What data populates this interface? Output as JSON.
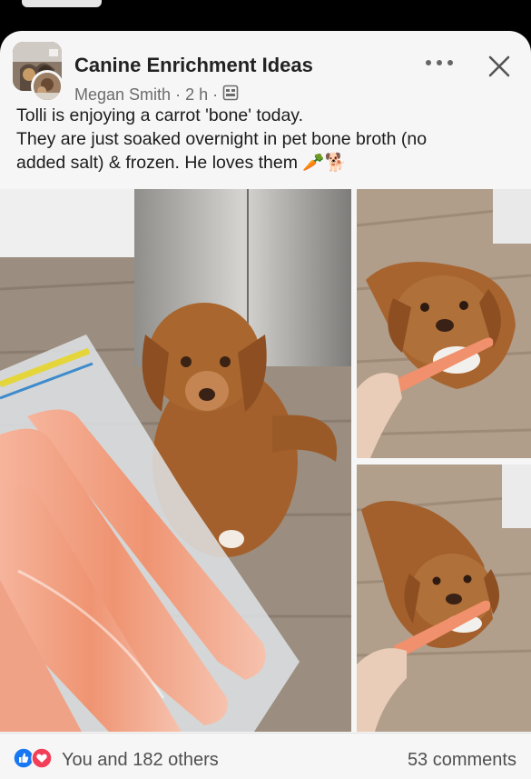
{
  "post": {
    "group_name": "Canine Enrichment Ideas",
    "author": "Megan Smith",
    "time": "2 h",
    "separator": "·",
    "lines": [
      "Tolli is enjoying a carrot 'bone' today.",
      "They are just soaked overnight in pet bone broth (no",
      "added salt) & frozen. He loves them"
    ],
    "emoji_carrot": "🥕",
    "emoji_dog": "🐕"
  },
  "reactions": {
    "text": "You and 182 others",
    "comments": "53 comments"
  },
  "icons": {
    "more": "more-icon",
    "close": "close-icon",
    "audience": "group-audience-icon",
    "like": "like-icon",
    "love": "love-icon"
  },
  "colors": {
    "like_blue": "#1877f2",
    "love_red": "#f33e58",
    "card_bg": "#f6f6f6",
    "carrot": "#f29a7c",
    "dog_fur": "#a8642f"
  }
}
